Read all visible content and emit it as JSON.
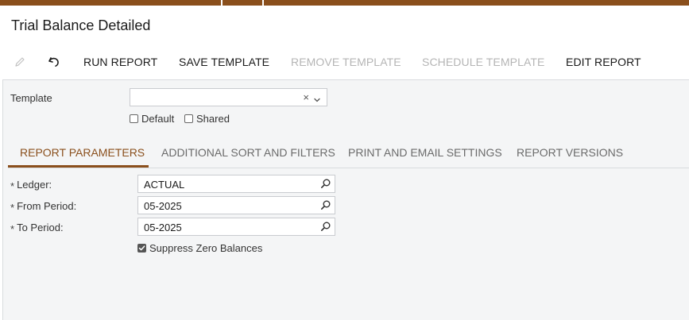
{
  "page": {
    "title": "Trial Balance Detailed"
  },
  "toolbar": {
    "edit_icon": "pencil-icon",
    "undo_icon": "undo-icon",
    "run_report": "RUN REPORT",
    "save_template": "SAVE TEMPLATE",
    "remove_template": "REMOVE TEMPLATE",
    "schedule_template": "SCHEDULE TEMPLATE",
    "edit_report": "EDIT REPORT"
  },
  "template": {
    "label": "Template",
    "value": "",
    "clear_glyph": "×",
    "default_label": "Default",
    "default_checked": false,
    "shared_label": "Shared",
    "shared_checked": false
  },
  "tabs": [
    {
      "label": "REPORT PARAMETERS",
      "active": true
    },
    {
      "label": "ADDITIONAL SORT AND FILTERS",
      "active": false
    },
    {
      "label": "PRINT AND EMAIL SETTINGS",
      "active": false
    },
    {
      "label": "REPORT VERSIONS",
      "active": false
    }
  ],
  "params": {
    "required_marker": "*",
    "ledger": {
      "label": "Ledger:",
      "value": "ACTUAL"
    },
    "from_period": {
      "label": "From Period:",
      "value": "05-2025"
    },
    "to_period": {
      "label": "To Period:",
      "value": "05-2025"
    },
    "suppress_zero": {
      "label": "Suppress Zero Balances",
      "checked": true
    }
  },
  "colors": {
    "accent": "#8a4f1c",
    "disabled_text": "#b5b5b5",
    "panel_bg": "#f4f5f6"
  }
}
